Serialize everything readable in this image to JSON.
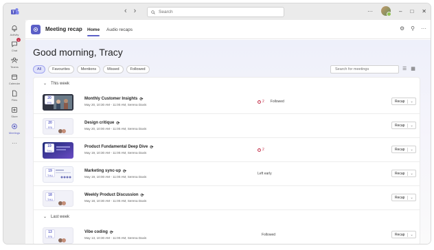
{
  "titlebar": {
    "nav_back": "‹",
    "nav_forward": "›",
    "search_placeholder": "Search",
    "more": "···",
    "minimize": "–",
    "maximize": "□",
    "close": "✕"
  },
  "rail": {
    "items": [
      {
        "label": "Activity",
        "icon": "bell-icon"
      },
      {
        "label": "Chat",
        "icon": "chat-icon",
        "badge": "1"
      },
      {
        "label": "Teams",
        "icon": "teams-icon"
      },
      {
        "label": "Calendar",
        "icon": "calendar-icon"
      },
      {
        "label": "Files",
        "icon": "file-icon"
      },
      {
        "label": "Store",
        "icon": "store-icon"
      },
      {
        "label": "Meetings",
        "icon": "meetings-icon"
      }
    ],
    "more": "···"
  },
  "app": {
    "title": "Meeting recap",
    "tabs": [
      "Home",
      "Audio recaps"
    ]
  },
  "home": {
    "greeting": "Good morning, Tracy",
    "filters": [
      "All",
      "Favourites",
      "Mentions",
      "Missed",
      "Followed"
    ],
    "search_placeholder": "Search for meetings"
  },
  "sections": [
    {
      "label": "This week",
      "meetings": [
        {
          "day": "20",
          "dow": "FRI",
          "title": "Monthly Customer Insights",
          "sub": "May 20, 10:30 AM - 11:00 AM, Serena Davis",
          "alert": "2",
          "status": "Followed",
          "recap": "Recap",
          "thumb": "video"
        },
        {
          "day": "20",
          "dow": "FRI",
          "title": "Design critique",
          "sub": "May 20, 10:00 AM - 11:00 AM, Serena Davis",
          "alert": "",
          "status": "",
          "recap": "Recap",
          "thumb": "plain"
        },
        {
          "day": "19",
          "dow": "THU",
          "title": "Product Fundamental Deep Dive",
          "sub": "May 19, 10:30 AM - 11:00 AM, Serena Davis",
          "alert": "2",
          "status": "",
          "recap": "Recap",
          "thumb": "slide"
        },
        {
          "day": "19",
          "dow": "THU",
          "title": "Marketing sync-up",
          "sub": "May 19, 10:00 AM - 11:00 AM, Serena Davis",
          "alert": "",
          "status": "Left early",
          "recap": "Recap",
          "thumb": "doc"
        },
        {
          "day": "18",
          "dow": "THU",
          "title": "Weekly Product Discussion",
          "sub": "May 18, 10:30 AM - 11:00 AM, Serena Davis",
          "alert": "",
          "status": "",
          "recap": "Recap",
          "thumb": "plain"
        }
      ]
    },
    {
      "label": "Last week",
      "meetings": [
        {
          "day": "13",
          "dow": "FRI",
          "title": "Vibe coding",
          "sub": "May 13, 10:30 AM - 11:00 AM, Serena Davis",
          "alert": "",
          "status": "Followed",
          "recap": "Recap",
          "thumb": "plain"
        }
      ]
    }
  ]
}
